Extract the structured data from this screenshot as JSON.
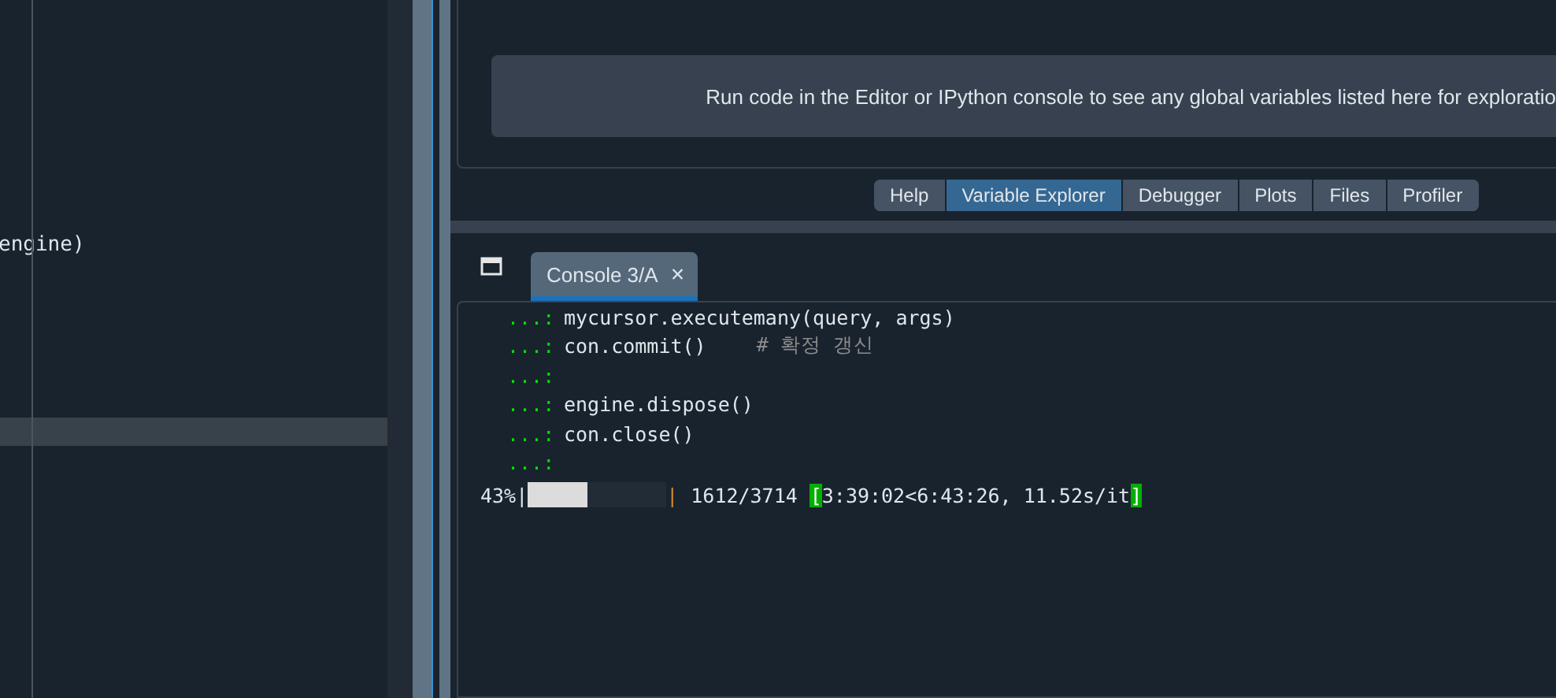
{
  "editor": {
    "lines": [
      {
        "text": "engine)",
        "current": false
      },
      {
        "current": true
      }
    ]
  },
  "variable_explorer": {
    "message": "Run code in the Editor or IPython console to see any global variables listed here for exploratio"
  },
  "pane_tabs": [
    {
      "label": "Help",
      "selected": false
    },
    {
      "label": "Variable Explorer",
      "selected": true
    },
    {
      "label": "Debugger",
      "selected": false
    },
    {
      "label": "Plots",
      "selected": false
    },
    {
      "label": "Files",
      "selected": false
    },
    {
      "label": "Profiler",
      "selected": false
    }
  ],
  "console_tabs": [
    {
      "label": "Console 3/A",
      "close": "×",
      "selected": true
    }
  ],
  "console": {
    "lines": [
      {
        "prompt": "...:",
        "code": "mycursor.executemany(query, args)"
      },
      {
        "prompt": "...:",
        "code": "con.commit()",
        "comment": "# 확정 갱신"
      },
      {
        "prompt": "...:"
      },
      {
        "prompt": "...:",
        "code": "engine.dispose()"
      },
      {
        "prompt": "...:",
        "code": "con.close()"
      },
      {
        "prompt": "...:"
      }
    ],
    "progress": {
      "percent": "43%|",
      "level": 0.43,
      "divider": "|",
      "count": "1612/3714",
      "open_bracket": "[",
      "timing": "3:39:02<6:43:26, 11.52s/it",
      "close_bracket": "]"
    }
  }
}
